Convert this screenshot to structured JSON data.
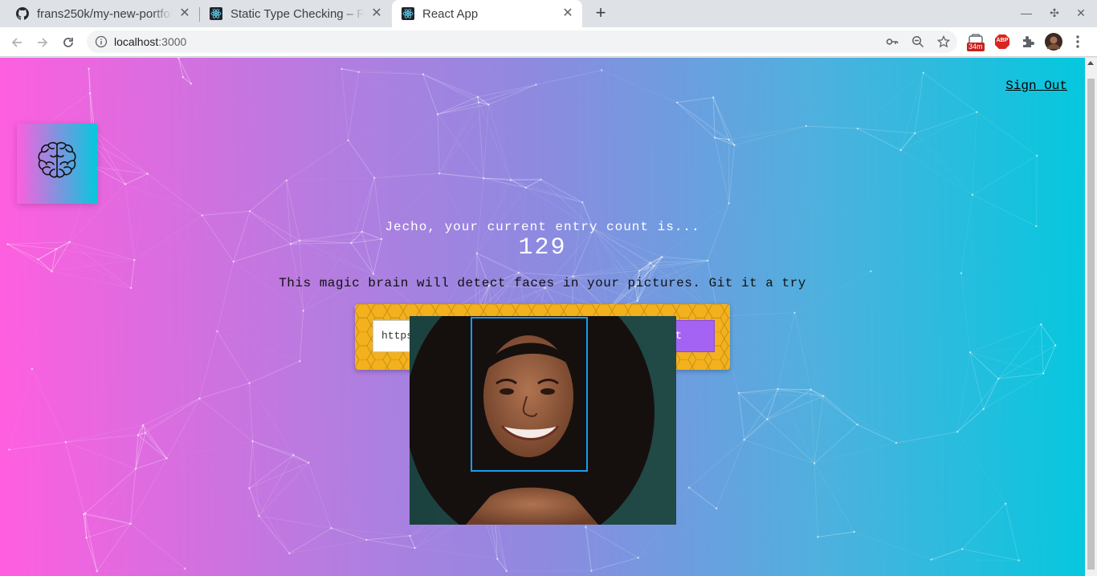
{
  "browser": {
    "tabs": [
      {
        "title": "frans250k/my-new-portfol",
        "icon": "github-icon",
        "active": false
      },
      {
        "title": "Static Type Checking – Re",
        "icon": "react-icon",
        "active": false
      },
      {
        "title": "React App",
        "icon": "react-icon",
        "active": true
      }
    ],
    "url_host": "localhost",
    "url_port": ":3000",
    "extension_badge": "34m",
    "abp_label": "ABP"
  },
  "app": {
    "sign_out": "Sign Out",
    "greeting": "Jecho, your current entry count is...",
    "entry_count": "129",
    "tagline": "This magic brain will detect faces in your pictures. Git it a try",
    "image_url_value": "https://goop-img.com/wp-content/upl",
    "detect_button": "Detect"
  },
  "colors": {
    "gradient_left": "#ff5edf",
    "gradient_right": "#04c8de",
    "form_background": "#f2b11d",
    "detect_button": "#a463f2",
    "face_box": "#149df2"
  }
}
